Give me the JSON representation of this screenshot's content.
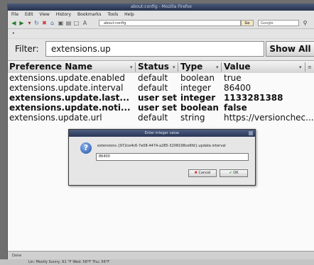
{
  "window": {
    "title": "about:config - Mozilla Firefox"
  },
  "menu": [
    "File",
    "Edit",
    "View",
    "History",
    "Bookmarks",
    "Tools",
    "Help"
  ],
  "nav": {
    "url": "about:config",
    "go_label": "Go",
    "search_placeholder": "Google"
  },
  "bookmarks": {
    "label": "•"
  },
  "filter": {
    "label": "Filter:",
    "value": "extensions.up",
    "show_all": "Show All"
  },
  "columns": [
    "Preference Name",
    "Status",
    "Type",
    "Value"
  ],
  "rows": [
    {
      "name": "extensions.update.enabled",
      "status": "default",
      "type": "boolean",
      "value": "true",
      "bold": false
    },
    {
      "name": "extensions.update.interval",
      "status": "default",
      "type": "integer",
      "value": "86400",
      "bold": false
    },
    {
      "name": "extensions.update.last...",
      "status": "user set",
      "type": "integer",
      "value": "1133281388",
      "bold": true
    },
    {
      "name": "extensions.update.noti...",
      "status": "user set",
      "type": "boolean",
      "value": "false",
      "bold": true
    },
    {
      "name": "extensions.update.url",
      "status": "default",
      "type": "string",
      "value": "https://versionchec...",
      "bold": false
    }
  ],
  "dialog": {
    "title": "Enter integer value",
    "message": "extensions.{972ce4c6-7e08-4474-a285-3208198ce6fd}.update.interval",
    "value": "86400",
    "cancel_label": "Cancel",
    "ok_label": "OK"
  },
  "statusbar": {
    "text": "Done"
  },
  "taskbar": {
    "text": "Lin: Mostly Sunny, 61 °F  Wed: 58°F  Thu: 56°F"
  },
  "colors": {
    "dialog_titlebar": "#2a3658",
    "window_titlebar": "#26324e",
    "cancel_icon": "#cc0000",
    "ok_icon": "#2a8a2a"
  }
}
